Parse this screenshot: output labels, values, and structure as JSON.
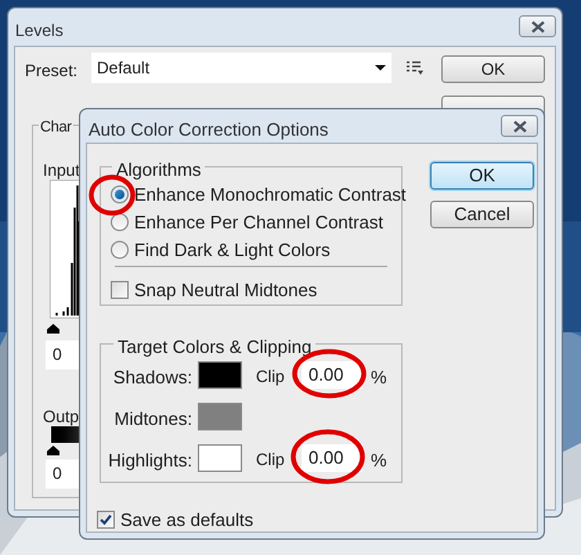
{
  "levels_dialog": {
    "title": "Levels",
    "preset": {
      "label": "Preset:",
      "value": "Default"
    },
    "buttons": [
      "OK"
    ],
    "channel_group_label": "Char",
    "input_label": "Input",
    "input_value": "0",
    "output_label": "Outp",
    "output_value": "0"
  },
  "auto_color_dialog": {
    "title": "Auto Color Correction Options",
    "algorithms": {
      "label": "Algorithms",
      "options": [
        {
          "label": "Enhance Monochromatic Contrast",
          "selected": true
        },
        {
          "label": "Enhance Per Channel Contrast",
          "selected": false
        },
        {
          "label": "Find Dark & Light Colors",
          "selected": false
        }
      ],
      "snap_neutral_midtones": {
        "label": "Snap Neutral Midtones",
        "checked": false
      }
    },
    "buttons": [
      "OK",
      "Cancel"
    ],
    "target": {
      "label": "Target Colors & Clipping",
      "rows": [
        {
          "label": "Shadows:",
          "color": "#000000",
          "clip_label": "Clip",
          "clip_value": "0.00",
          "unit": "%"
        },
        {
          "label": "Midtones:",
          "color": "#808080"
        },
        {
          "label": "Highlights:",
          "color": "#ffffff",
          "clip_label": "Clip",
          "clip_value": "0.00",
          "unit": "%"
        }
      ]
    },
    "save_as_defaults": {
      "label": "Save as defaults",
      "checked": true
    }
  }
}
